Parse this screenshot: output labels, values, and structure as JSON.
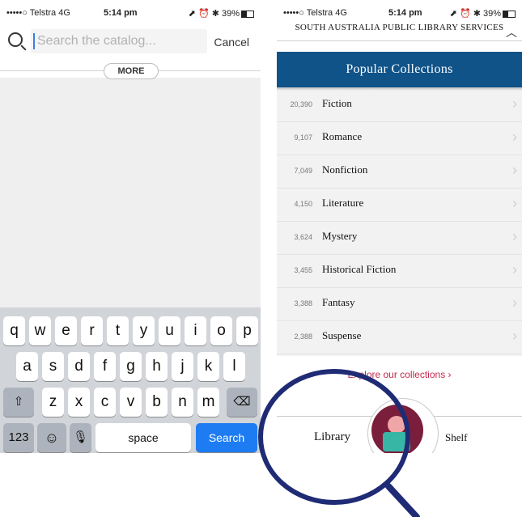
{
  "left": {
    "status": {
      "carrier": "•••••○ Telstra  4G",
      "time": "5:14 pm",
      "right": "⬈ ⏰ ✱ 39%"
    },
    "search": {
      "placeholder": "Search the catalog...",
      "cancel": "Cancel"
    },
    "more_label": "MORE",
    "keyboard": {
      "row1": [
        "q",
        "w",
        "e",
        "r",
        "t",
        "y",
        "u",
        "i",
        "o",
        "p"
      ],
      "row2": [
        "a",
        "s",
        "d",
        "f",
        "g",
        "h",
        "j",
        "k",
        "l"
      ],
      "row3": [
        "z",
        "x",
        "c",
        "v",
        "b",
        "n",
        "m"
      ],
      "shift": "⇧",
      "backspace": "⌫",
      "numbers": "123",
      "emoji": "☺",
      "mic": "🎙",
      "space": "space",
      "search": "Search"
    }
  },
  "right": {
    "status": {
      "carrier": "•••••○ Telstra  4G",
      "time": "5:14 pm",
      "right": "⬈ ⏰ ✱ 39%"
    },
    "header_title": "SOUTH AUSTRALIA PUBLIC LIBRARY SERVICES",
    "header_chevron": "︿",
    "banner_title": "Popular Collections",
    "collections": [
      {
        "count": "20,390",
        "name": "Fiction"
      },
      {
        "count": "9,107",
        "name": "Romance"
      },
      {
        "count": "7,049",
        "name": "Nonfiction"
      },
      {
        "count": "4,150",
        "name": "Literature"
      },
      {
        "count": "3,624",
        "name": "Mystery"
      },
      {
        "count": "3,455",
        "name": "Historical Fiction"
      },
      {
        "count": "3,388",
        "name": "Fantasy"
      },
      {
        "count": "2,388",
        "name": "Suspense"
      }
    ],
    "row_chevron": "›",
    "explore_link": "Explore our collections ›",
    "tabs": {
      "library": "Library",
      "shelf": "Shelf"
    }
  },
  "colors": {
    "banner": "#0f5389",
    "search_button": "#1e7cf2",
    "explore_link": "#c0294f",
    "magnifier": "#1f2b74"
  }
}
